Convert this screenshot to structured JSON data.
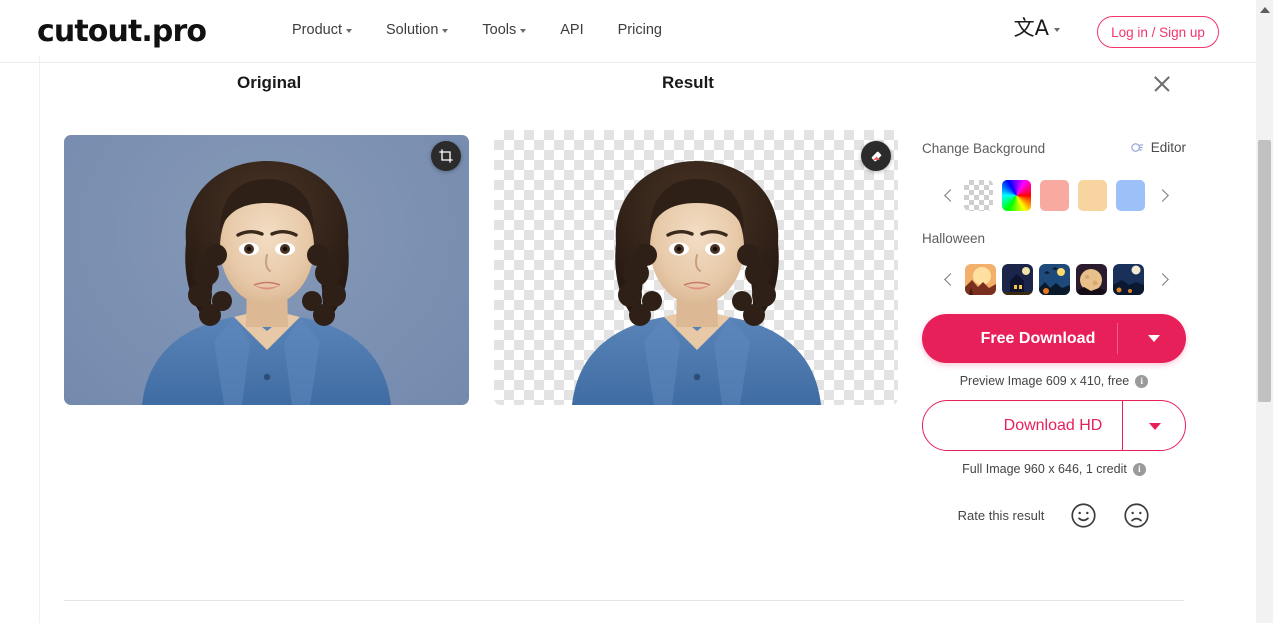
{
  "header": {
    "logo": "cutout.pro",
    "nav": [
      {
        "label": "Product",
        "has_caret": true
      },
      {
        "label": "Solution",
        "has_caret": true
      },
      {
        "label": "Tools",
        "has_caret": true
      },
      {
        "label": "API",
        "has_caret": false
      },
      {
        "label": "Pricing",
        "has_caret": false
      }
    ],
    "language_icon": "translate-icon",
    "login_label": "Log in / Sign up",
    "accent_color": "#f2366a"
  },
  "panel": {
    "original_title": "Original",
    "result_title": "Result",
    "close_icon": "close-icon",
    "crop_icon": "crop-icon",
    "eraser_icon": "eraser-icon"
  },
  "sidebar": {
    "change_background_label": "Change Background",
    "editor_label": "Editor",
    "editor_icon": "magic-wand-icon",
    "prev_icon": "chevron-left-icon",
    "next_icon": "chevron-right-icon",
    "swatches": [
      {
        "name": "transparent",
        "color": "transparent"
      },
      {
        "name": "rainbow",
        "color": "rainbow"
      },
      {
        "name": "salmon",
        "color": "#f8a9a0"
      },
      {
        "name": "peach",
        "color": "#f8d5a0"
      },
      {
        "name": "blue",
        "color": "#9cc0f8"
      }
    ],
    "category_label": "Halloween",
    "thumbnails": [
      {
        "name": "halloween-sunset"
      },
      {
        "name": "halloween-haunted-house"
      },
      {
        "name": "halloween-bats-night"
      },
      {
        "name": "halloween-full-moon"
      },
      {
        "name": "halloween-moonlit-field"
      }
    ],
    "free_download_label": "Free Download",
    "free_download_caption": "Preview Image 609 x 410, free",
    "download_hd_label": "Download HD",
    "download_hd_caption": "Full Image 960 x 646, 1 credit",
    "info_icon": "info-icon",
    "caret_icon": "caret-down-icon",
    "rate_label": "Rate this result",
    "rate_positive_icon": "smiley-face-icon",
    "rate_negative_icon": "frowning-face-icon",
    "primary_color": "#e8205a"
  },
  "scrollbar": {
    "up_arrow_icon": "scroll-up-arrow-icon"
  }
}
